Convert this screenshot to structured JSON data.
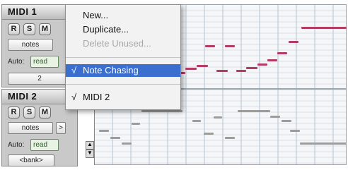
{
  "tracks": [
    {
      "name": "MIDI 1",
      "buttons": [
        "R",
        "S",
        "M"
      ],
      "view": "notes",
      "auto_label": "Auto:",
      "auto_value": "read",
      "voice": "2"
    },
    {
      "name": "MIDI 2",
      "buttons": [
        "R",
        "S",
        "M"
      ],
      "view": "notes",
      "view_arrow": ">",
      "auto_label": "Auto:",
      "auto_value": "read",
      "voice": "<bank>"
    }
  ],
  "menu": {
    "items": [
      {
        "label": "New...",
        "state": "enabled"
      },
      {
        "label": "Duplicate...",
        "state": "enabled"
      },
      {
        "label": "Delete Unused...",
        "state": "disabled"
      },
      {
        "label": "Note Chasing",
        "state": "highlighted",
        "checked": true
      },
      {
        "label": "MIDI 2",
        "state": "enabled",
        "checked": true
      }
    ],
    "check_glyph": "√"
  },
  "colors": {
    "note": "#b43c62",
    "note_alt": "#9c9c9c",
    "highlight": "#3a6fd0",
    "automation_green": "#2e5c2e"
  }
}
